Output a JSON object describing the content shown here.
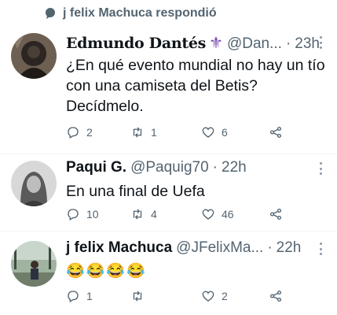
{
  "banner": {
    "text": "j felix Machuca respondió"
  },
  "tweets": [
    {
      "name": "Edmundo Dantés",
      "name_symbol": "⚜",
      "handle": "@Dan...",
      "time": "23h",
      "text": "¿En qué evento mundial no hay un tío con una camiseta del Betis? Decídmelo.",
      "replies": "2",
      "retweets": "1",
      "likes": "6"
    },
    {
      "name": "Paqui G.",
      "handle": "@Paquig70",
      "time": "22h",
      "text": "En una final de Uefa",
      "replies": "10",
      "retweets": "4",
      "likes": "46"
    },
    {
      "name": "j felix Machuca",
      "handle": "@JFelixMa...",
      "time": "22h",
      "text": "😂😂😂😂",
      "replies": "1",
      "retweets": "",
      "likes": "2"
    }
  ],
  "colors": {
    "secondary": "#536471",
    "text": "#0f1419",
    "accent_purple": "#7a4fb0"
  }
}
